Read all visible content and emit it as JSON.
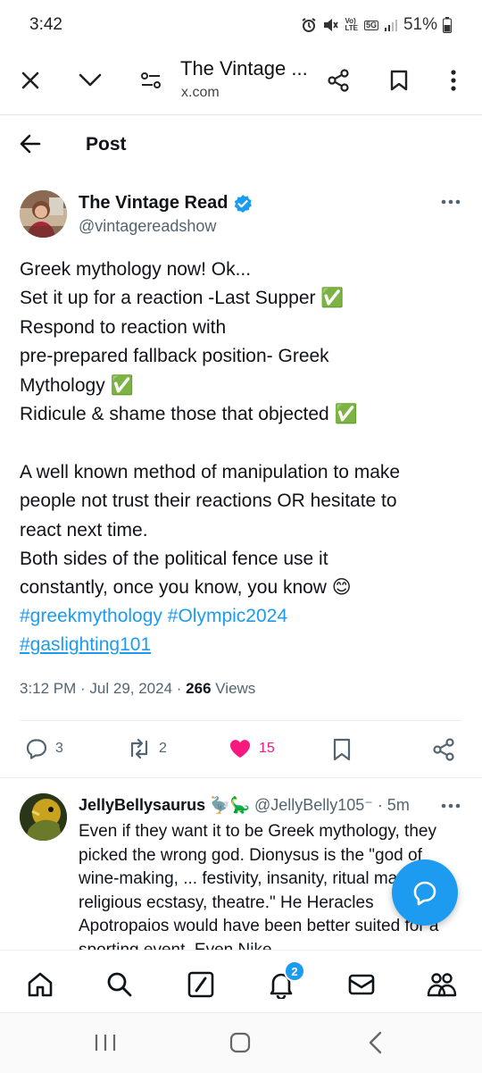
{
  "status": {
    "time": "3:42",
    "battery": "51%",
    "vol_lte": "Vo)\nLTE",
    "network": "5G"
  },
  "browser": {
    "title": "The Vintage ...",
    "domain": "x.com"
  },
  "header": {
    "title": "Post"
  },
  "post": {
    "author_name": "The Vintage Read",
    "author_handle": "@vintagereadshow",
    "text": "Greek mythology now! Ok...\nSet it up for a reaction -Last Supper ✅\nRespond to reaction with\npre-prepared fallback position- Greek\nMythology ✅\nRidicule & shame those that objected ✅\n\nA well known method of manipulation to make\npeople not trust their reactions OR hesitate to\nreact next time.\nBoth sides of the political fence use it\nconstantly, once you know, you know 😊",
    "hashtags": [
      "#greekmythology",
      "#Olympic2024",
      "#gaslighting101"
    ],
    "timestamp": "3:12 PM · Jul 29, 2024 · ",
    "views_count": "266",
    "views_label": "Views",
    "replies": "3",
    "reposts": "2",
    "likes": "15"
  },
  "reply": {
    "name": "JellyBellysaurus",
    "emojis": "🦤🦕",
    "handle": "@JellyBelly105⁻",
    "time": "· 5m",
    "text": "Even if they want it to be Greek mythology, they picked the wrong god. Dionysus is the \"god of wine-making, ... festivity, insanity, ritual madness, religious ecstasy, theatre.\" He Heracles Apotropaios would have been better suited for a sporting event. Even Nike"
  },
  "nav": {
    "notifications_badge": "2"
  },
  "colors": {
    "accent": "#1d9bf0",
    "like": "#f91880",
    "verified": "#1d9bf0"
  }
}
